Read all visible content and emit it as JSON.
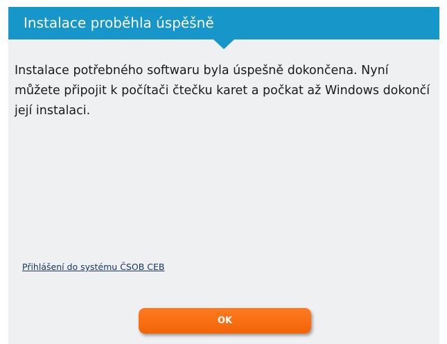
{
  "header": {
    "title": "Instalace proběhla úspěšně"
  },
  "body": {
    "message": "Instalace potřebného softwaru byla úspešně dokončena. Nyní můžete připojit k počítači čtečku karet a počkat až Windows dokončí její instalaci."
  },
  "links": {
    "login": "Přihlášení do systému ČSOB CEB"
  },
  "buttons": {
    "ok": "OK"
  },
  "colors": {
    "header": "#1796c9",
    "background": "#eef0f2",
    "button": "#f26405"
  }
}
